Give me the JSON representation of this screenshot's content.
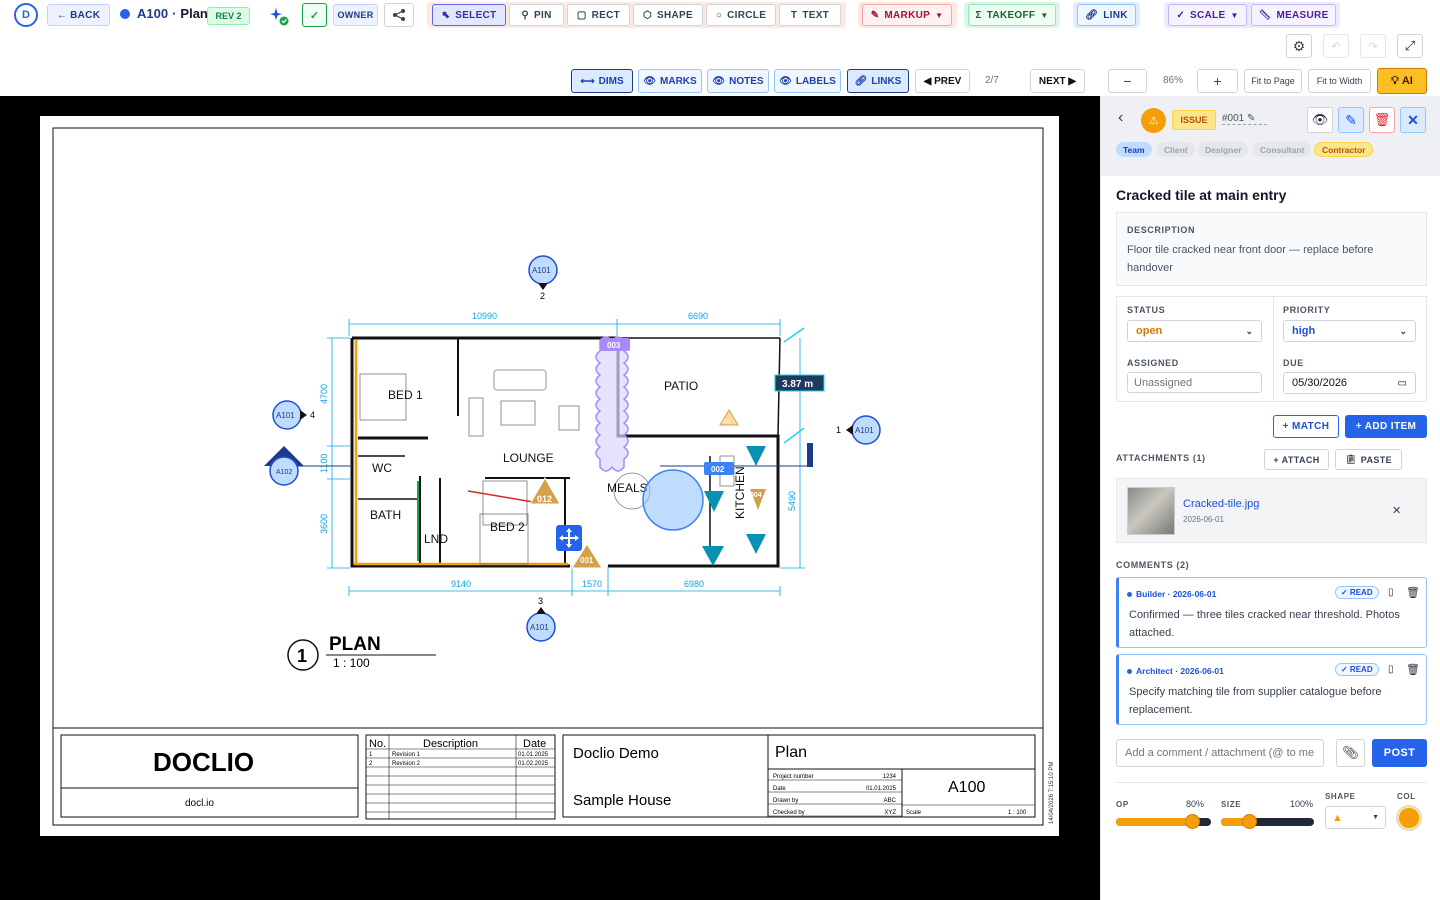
{
  "toolbar": {
    "back": "← BACK",
    "sheet_code": "A100",
    "sheet_sep": "·",
    "sheet_name": "Plan",
    "rev": "REV 2",
    "owner": "OWNER",
    "tools": {
      "select": "SELECT",
      "pin": "PIN",
      "rect": "RECT",
      "shape": "SHAPE",
      "circle": "CIRCLE",
      "text": "TEXT",
      "markup": "MARKUP",
      "takeoff": "TAKEOFF",
      "link": "LINK",
      "scale": "SCALE",
      "measure": "MEASURE"
    }
  },
  "viewbar": {
    "dims": "DIMS",
    "marks": "MARKS",
    "notes": "NOTES",
    "labels": "LABELS",
    "links": "LINKS",
    "prev": "◀ PREV",
    "page": "2/7",
    "next": "NEXT ▶",
    "zoom_out": "−",
    "zoom": "86%",
    "zoom_in": "+",
    "fit_page": "Fit to Page",
    "fit_width": "Fit to Width",
    "ai": "AI"
  },
  "drawing": {
    "rooms": {
      "bed1": "BED 1",
      "lounge": "LOUNGE",
      "patio": "PATIO",
      "wc": "WC",
      "bath": "BATH",
      "lnd": "LND",
      "bed2": "BED 2",
      "meals": "MEALS",
      "kitchen": "KITCHEN"
    },
    "dims": {
      "top_left": "10990",
      "top_right": "6690",
      "bot_left": "9140",
      "bot_mid": "1570",
      "bot_right": "6980",
      "left_top": "4700",
      "left_mid": "1100",
      "left_bot": "3600",
      "right": "5490"
    },
    "measure": "3.87 m",
    "refs": {
      "a101": "A101",
      "a102": "A102",
      "n1": "1",
      "n2": "2",
      "n3": "3",
      "n4": "4"
    },
    "pins": {
      "p003": "003",
      "p012": "012",
      "p001": "001",
      "p002": "002",
      "p011": "011",
      "p004": "004"
    },
    "title": {
      "num": "1",
      "name": "PLAN",
      "scale": "1 : 100"
    },
    "block": {
      "company": "DOCLIO",
      "web": "docl.io",
      "no": "No.",
      "desc": "Description",
      "date": "Date",
      "revs": [
        {
          "no": "1",
          "desc": "Revision 1",
          "date": "01.01.2025"
        },
        {
          "no": "2",
          "desc": "Revision 2",
          "date": "01.02.2025"
        }
      ],
      "project": "Doclio Demo",
      "site": "Sample House",
      "sheet_title": "Plan",
      "sheet_no": "A100",
      "meta": [
        {
          "k": "Project number",
          "v": "1234"
        },
        {
          "k": "Date",
          "v": "01.01.2025"
        },
        {
          "k": "Drawn by",
          "v": "ABC"
        },
        {
          "k": "Checked by",
          "v": "XYZ"
        }
      ],
      "scale_k": "Scale",
      "scale_v": "1 : 100",
      "stamp": "14/04/2026 7:15:10 PM"
    }
  },
  "panel": {
    "type": "ISSUE",
    "id": "#001 ✎",
    "audience": [
      "Team",
      "Client",
      "Designer",
      "Consultant",
      "Contractor"
    ],
    "title": "Cracked tile at main entry",
    "desc_label": "DESCRIPTION",
    "desc": "Floor tile cracked near front door — replace before handover",
    "status_label": "STATUS",
    "status": "open",
    "priority_label": "PRIORITY",
    "priority": "high",
    "assigned_label": "ASSIGNED",
    "assigned_placeholder": "Unassigned",
    "due_label": "DUE",
    "due": "05/30/2026",
    "match": "+ MATCH",
    "add_item": "+ ADD ITEM",
    "attach_label": "ATTACHMENTS (1)",
    "attach_btn": "+ ATTACH",
    "paste_btn": "PASTE",
    "file": "Cracked-tile.jpg",
    "file_date": "2026-06-01",
    "comments_label": "COMMENTS (2)",
    "comments": [
      {
        "author": "Builder · 2026-06-01",
        "read": "✓ READ",
        "text": "Confirmed — three tiles cracked near threshold. Photos attached."
      },
      {
        "author": "Architect · 2026-06-01",
        "read": "✓ READ",
        "text": "Specify matching tile from supplier catalogue before replacement."
      }
    ],
    "comment_placeholder": "Add a comment / attachment (@ to me",
    "post": "POST",
    "op_label": "OP",
    "op": "80%",
    "size_label": "SIZE",
    "size": "100%",
    "shape_label": "SHAPE",
    "col_label": "COL",
    "op_value": 0.8,
    "size_value": 0.3
  },
  "colors": {
    "accent": "#2563eb",
    "issue": "#f59e0b",
    "pin_purple": "#a78bfa",
    "teal": "#0891b2"
  }
}
